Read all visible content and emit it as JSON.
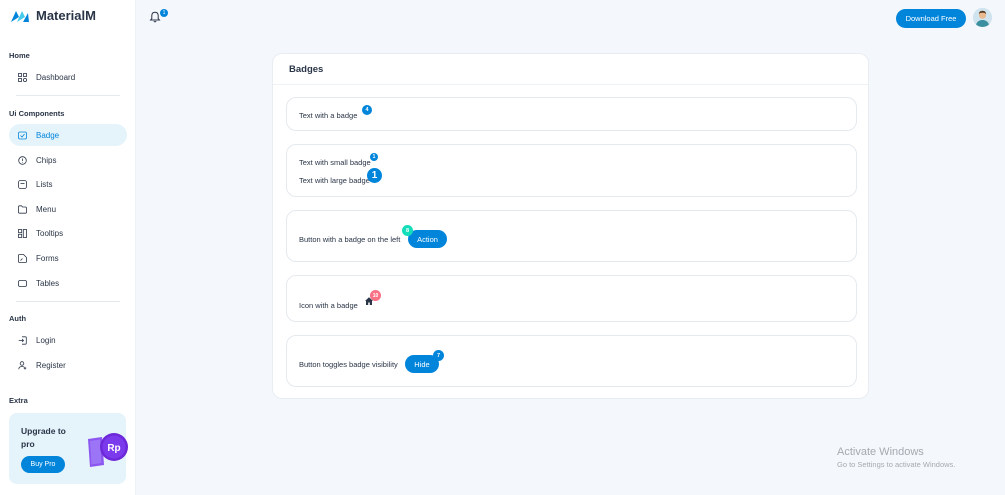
{
  "brand": {
    "name": "MaterialM"
  },
  "colors": {
    "primary": "#0085db",
    "success": "#13deb9",
    "danger": "#fb7185"
  },
  "sidebar": {
    "sections": [
      {
        "label": "Home"
      },
      {
        "label": "Ui Components"
      },
      {
        "label": "Auth"
      },
      {
        "label": "Extra"
      }
    ],
    "items": [
      {
        "label": "Dashboard",
        "icon": "dashboard-icon"
      },
      {
        "label": "Badge",
        "icon": "badge-icon",
        "active": true
      },
      {
        "label": "Chips",
        "icon": "chips-icon"
      },
      {
        "label": "Lists",
        "icon": "lists-icon"
      },
      {
        "label": "Menu",
        "icon": "menu-icon"
      },
      {
        "label": "Tooltips",
        "icon": "tooltips-icon"
      },
      {
        "label": "Forms",
        "icon": "forms-icon"
      },
      {
        "label": "Tables",
        "icon": "tables-icon"
      },
      {
        "label": "Login",
        "icon": "login-icon"
      },
      {
        "label": "Register",
        "icon": "register-icon"
      }
    ],
    "upgrade": {
      "title": "Upgrade to pro",
      "button": "Buy Pro",
      "art_text": "Rp"
    }
  },
  "topbar": {
    "notification_count": "1",
    "download_label": "Download Free"
  },
  "card": {
    "title": "Badges",
    "text_badge": {
      "label": "Text with a badge",
      "badge": "4"
    },
    "small_badge": {
      "label": "Text with small badge",
      "badge": "1"
    },
    "large_badge": {
      "label": "Text with large badge",
      "badge": "1"
    },
    "button_left": {
      "label": "Button with a badge on the left",
      "badge": "8",
      "button": "Action"
    },
    "icon_badge": {
      "label": "Icon with a badge",
      "badge": "10"
    },
    "toggle": {
      "label": "Button toggles badge visibility",
      "badge": "7",
      "button": "Hide"
    }
  },
  "watermark": {
    "line1": "Activate Windows",
    "line2": "Go to Settings to activate Windows."
  }
}
